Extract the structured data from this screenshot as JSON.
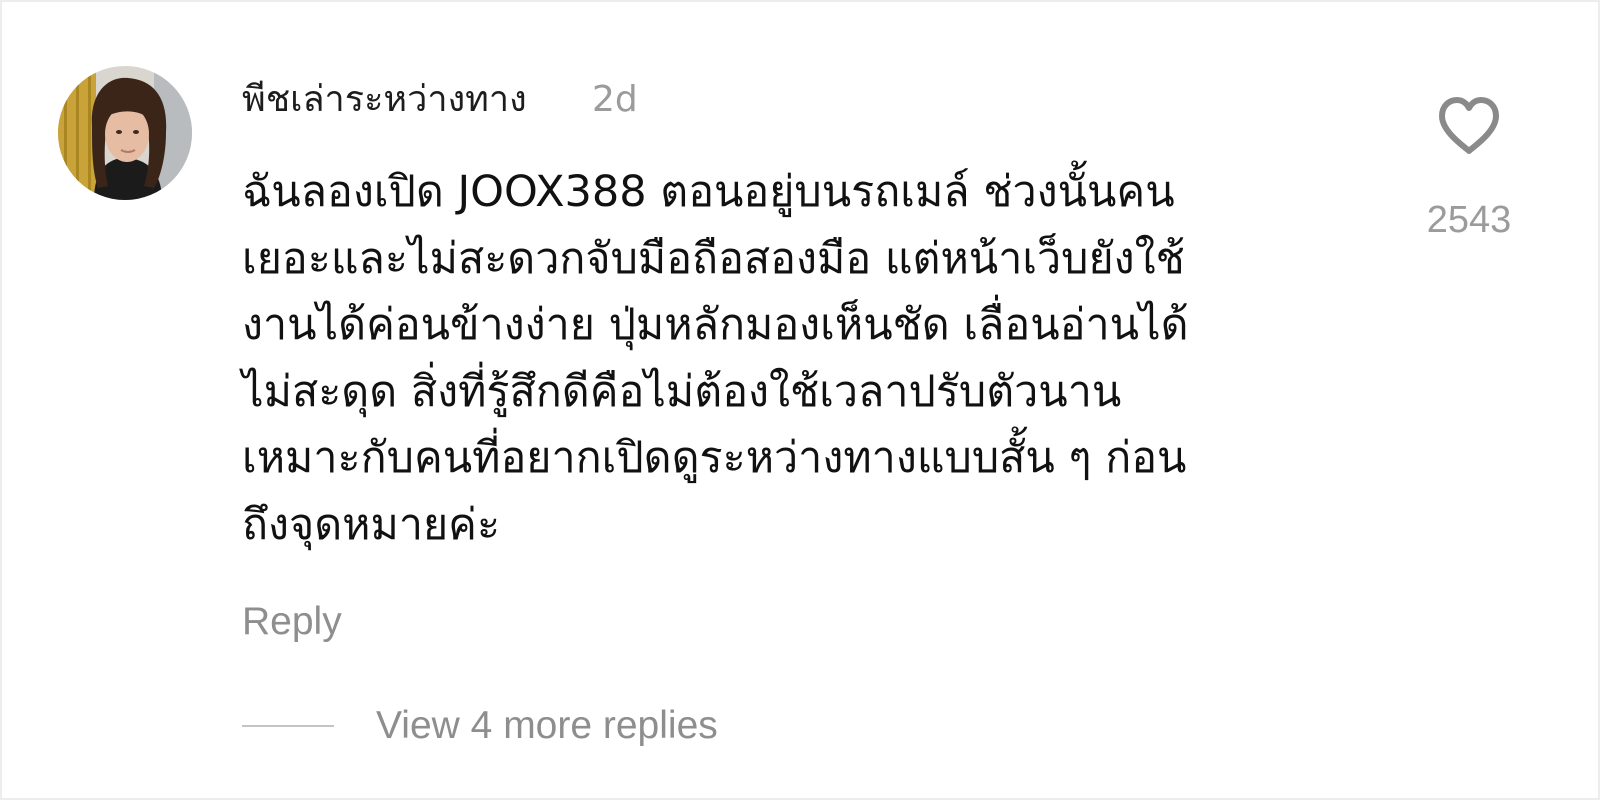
{
  "comment": {
    "username": "พีชเล่าระหว่างทาง",
    "time_ago": "2d",
    "body_lines": [
      "ฉันลองเปิด JOOX388 ตอนอยู่บนรถเมล์ ช่วงนั้นคน",
      "เยอะและไม่สะดวกจับมือถือสองมือ แต่หน้าเว็บยังใช้",
      "งานได้ค่อนข้างง่าย ปุ่มหลักมองเห็นชัด เลื่อนอ่านได้",
      "ไม่สะดุด สิ่งที่รู้สึกดีคือไม่ต้องใช้เวลาปรับตัวนาน",
      "เหมาะกับคนที่อยากเปิดดูระหว่างทางแบบสั้น ๆ ก่อน",
      "ถึงจุดหมายค่ะ"
    ],
    "reply_label": "Reply",
    "view_replies_label": "View 4 more replies",
    "like_count": "2543",
    "like_icon": "heart-outline-icon"
  },
  "colors": {
    "background": "#ffffff",
    "text_primary": "#111111",
    "text_secondary": "#9b9b9b",
    "icon": "#8a8a8a"
  }
}
